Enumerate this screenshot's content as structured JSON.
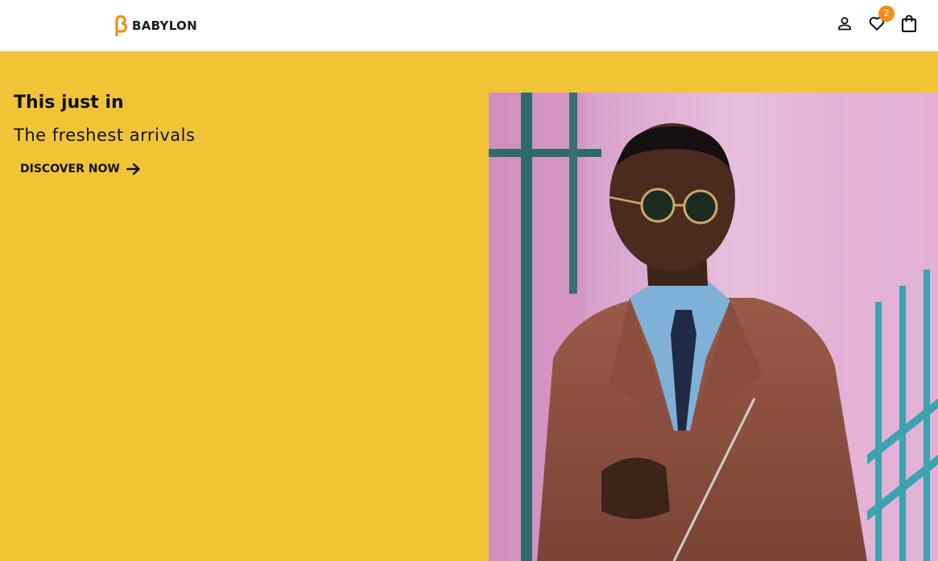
{
  "header": {
    "brand": "BABYLON",
    "icons": {
      "account": "user-icon",
      "wishlist": "heart-icon",
      "cart": "shopping-bag-icon"
    },
    "wishlist_count": "2"
  },
  "hero": {
    "title": "This just in",
    "subtitle": "The freshest arrivals",
    "cta_label": "DISCOVER NOW",
    "cta_icon": "arrow-right-icon",
    "image_description_icon": "hero-photo"
  },
  "colors": {
    "hero_background": "#f1c438",
    "brand_accent": "#f28c1a",
    "badge": "#f28c1a",
    "text": "#111111"
  }
}
